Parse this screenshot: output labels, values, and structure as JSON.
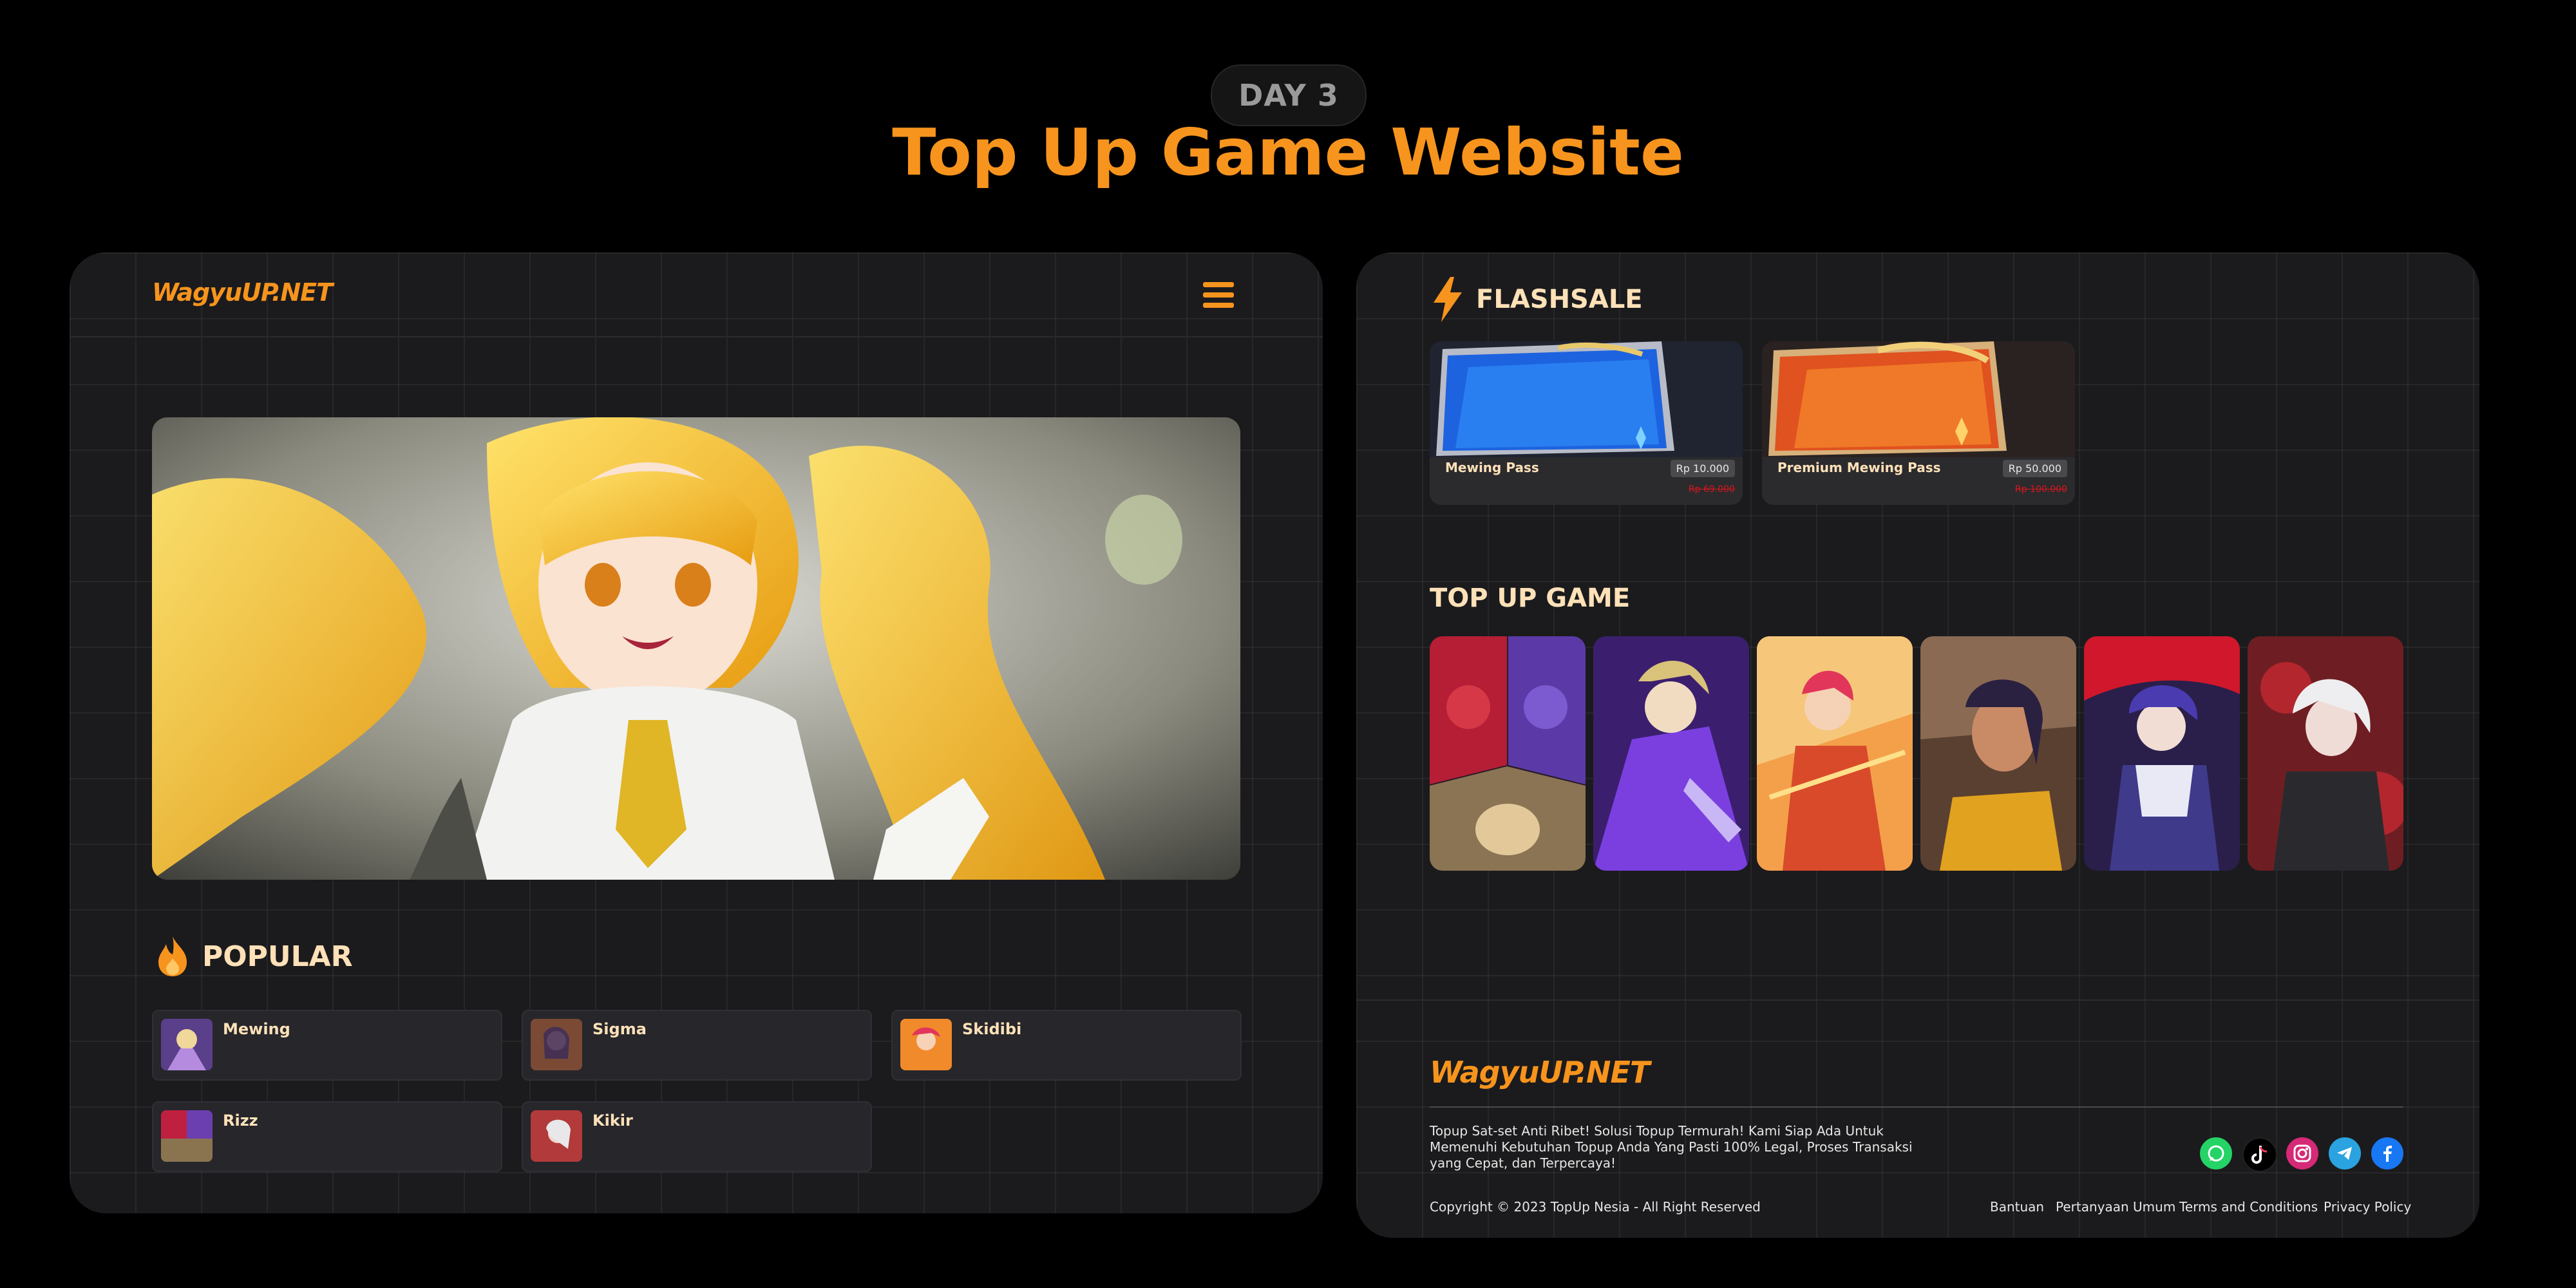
{
  "header": {
    "day_label": "DAY 3",
    "title": "Top Up Game Website"
  },
  "colors": {
    "accent": "#f7941d",
    "panel": "#1b1b1d",
    "card": "#26262b",
    "strike_red": "#d3161a"
  },
  "left_panel": {
    "logo": "WagyuUP.NET",
    "menu_icon": "hamburger-menu-icon",
    "popular": {
      "icon": "fire-icon",
      "title": "POPULAR",
      "items": [
        {
          "name": "Mewing"
        },
        {
          "name": "Sigma"
        },
        {
          "name": "Skidibi"
        },
        {
          "name": "Rizz"
        },
        {
          "name": "Kikir"
        }
      ]
    }
  },
  "right_panel": {
    "flashsale": {
      "icon": "lightning-icon",
      "title": "FLASHSALE",
      "items": [
        {
          "name": "Mewing Pass",
          "price": "Rp 10.000",
          "old_price": "Rp 69.000"
        },
        {
          "name": "Premium Mewing Pass",
          "price": "Rp 50.000",
          "old_price": "Rp 100.000"
        }
      ]
    },
    "topup": {
      "title": "TOP UP GAME",
      "game_count": 6
    },
    "footer": {
      "logo": "WagyuUP.NET",
      "description": "Topup Sat-set Anti Ribet! Solusi Topup Termurah! Kami Siap Ada Untuk Memenuhi Kebutuhan Topup Anda Yang Pasti 100% Legal, Proses Transaksi yang Cepat, dan Terpercaya!",
      "copyright": "Copyright © 2023 TopUp Nesia - All Right Reserved",
      "socials": [
        {
          "icon": "whatsapp-icon",
          "color": "#25d366"
        },
        {
          "icon": "tiktok-icon",
          "color": "#000000"
        },
        {
          "icon": "instagram-icon",
          "color": "#d62976"
        },
        {
          "icon": "telegram-icon",
          "color": "#2aa3e0"
        },
        {
          "icon": "facebook-icon",
          "color": "#1877f2"
        }
      ],
      "links": [
        "Bantuan",
        "Pertanyaan Umum",
        "Terms and Conditions",
        "Privacy Policy"
      ]
    }
  }
}
